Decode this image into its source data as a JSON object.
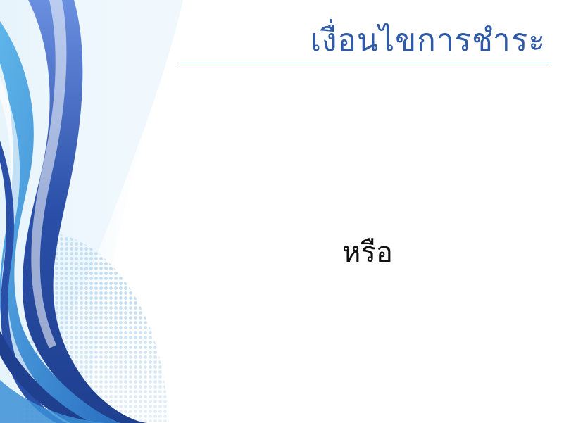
{
  "slide": {
    "title": "เงื่อนไขการชำระ",
    "body_text": "หรือ"
  },
  "colors": {
    "title": "#2f5aa8",
    "rule": "#6aa6d8",
    "swirl_dark": "#2a4fa8",
    "swirl_mid": "#3a8fd6",
    "swirl_light": "#bfe0f5",
    "dots": "#9cc8e8"
  }
}
